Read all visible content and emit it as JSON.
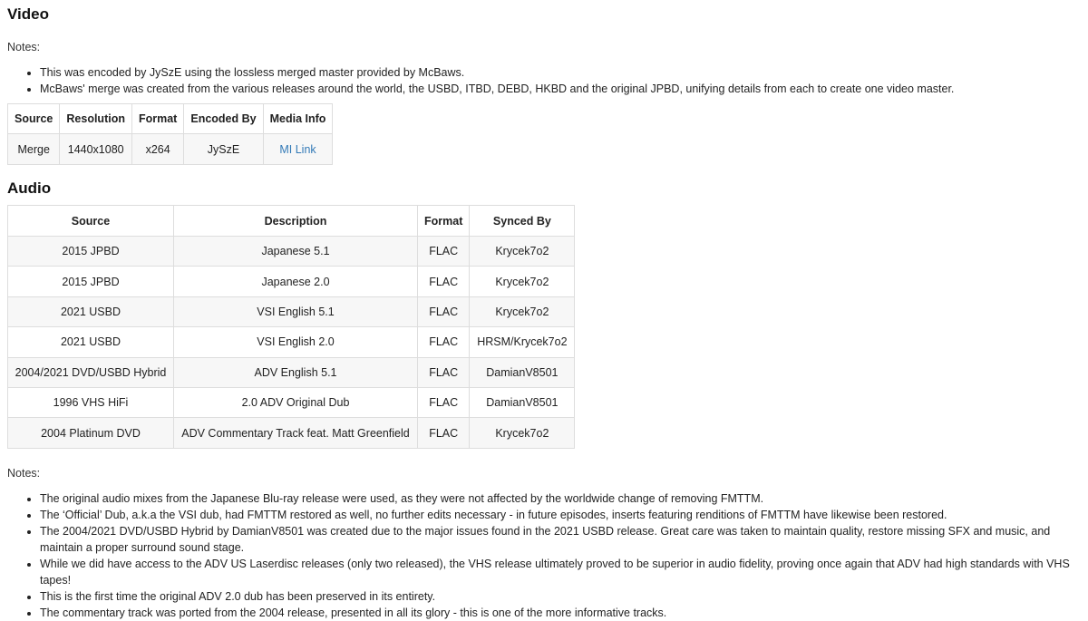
{
  "video": {
    "heading": "Video",
    "notes_label": "Notes:",
    "notes": [
      "This was encoded by JySzE using the lossless merged master provided by McBaws.",
      "McBaws' merge was created from the various releases around the world, the USBD, ITBD, DEBD, HKBD and the original JPBD, unifying details from each to create one video master."
    ],
    "table": {
      "headers": [
        "Source",
        "Resolution",
        "Format",
        "Encoded By",
        "Media Info"
      ],
      "row": {
        "source": "Merge",
        "resolution": "1440x1080",
        "format": "x264",
        "encoded_by": "JySzE",
        "media_info": "MI Link"
      }
    }
  },
  "audio": {
    "heading": "Audio",
    "table": {
      "headers": [
        "Source",
        "Description",
        "Format",
        "Synced By"
      ],
      "rows": [
        {
          "source": "2015 JPBD",
          "description": "Japanese 5.1",
          "format": "FLAC",
          "synced_by": "Krycek7o2"
        },
        {
          "source": "2015 JPBD",
          "description": "Japanese 2.0",
          "format": "FLAC",
          "synced_by": "Krycek7o2"
        },
        {
          "source": "2021 USBD",
          "description": "VSI English 5.1",
          "format": "FLAC",
          "synced_by": "Krycek7o2"
        },
        {
          "source": "2021 USBD",
          "description": "VSI English 2.0",
          "format": "FLAC",
          "synced_by": "HRSM/Krycek7o2"
        },
        {
          "source": "2004/2021 DVD/USBD Hybrid",
          "description": "ADV English 5.1",
          "format": "FLAC",
          "synced_by": "DamianV8501"
        },
        {
          "source": "1996 VHS HiFi",
          "description": "2.0 ADV Original Dub",
          "format": "FLAC",
          "synced_by": "DamianV8501"
        },
        {
          "source": "2004 Platinum DVD",
          "description": "ADV Commentary Track feat. Matt Greenfield",
          "format": "FLAC",
          "synced_by": "Krycek7o2"
        }
      ]
    },
    "notes_label": "Notes:",
    "notes": [
      "The original audio mixes from the Japanese Blu-ray release were used, as they were not affected by the worldwide change of removing FMTTM.",
      "The ‘Official’ Dub, a.k.a the VSI dub, had FMTTM restored as well, no further edits necessary - in future episodes, inserts featuring renditions of FMTTM have likewise been restored.",
      "The 2004/2021 DVD/USBD Hybrid by DamianV8501 was created due to the major issues found in the 2021 USBD release. Great care was taken to maintain quality, restore missing SFX and music, and maintain a proper surround sound stage.",
      "While we did have access to the ADV US Laserdisc releases (only two released), the VHS release ultimately proved to be superior in audio fidelity, proving once again that ADV had high standards with VHS tapes!",
      "This is the first time the original ADV 2.0 dub has been preserved in its entirety.",
      "The commentary track was ported from the 2004 release, presented in all its glory - this is one of the more informative tracks."
    ]
  },
  "colors": {
    "link": "#337ab7",
    "border": "#dddddd",
    "row_alt": "#f7f7f7"
  }
}
